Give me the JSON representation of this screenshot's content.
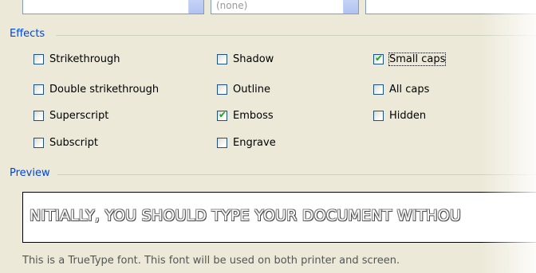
{
  "top_controls": {
    "combo2_value": "(none)"
  },
  "effects": {
    "title": "Effects",
    "options": [
      {
        "label": "Strikethrough",
        "checked": false
      },
      {
        "label": "Double strikethrough",
        "checked": false
      },
      {
        "label": "Superscript",
        "checked": false
      },
      {
        "label": "Subscript",
        "checked": false
      },
      {
        "label": "Shadow",
        "checked": false
      },
      {
        "label": "Outline",
        "checked": false
      },
      {
        "label": "Emboss",
        "checked": true
      },
      {
        "label": "Engrave",
        "checked": false
      },
      {
        "label": "Small caps",
        "checked": true
      },
      {
        "label": "All caps",
        "checked": false
      },
      {
        "label": "Hidden",
        "checked": false
      }
    ]
  },
  "preview": {
    "title": "Preview",
    "sample_text": "NITIALLY, YOU SHOULD TYPE YOUR DOCUMENT WITHOU",
    "note": "This is a TrueType font. This font will be used on both printer and screen."
  },
  "colors": {
    "group_title": "#0046d5",
    "checkmark": "#21a121",
    "dialog_bg": "#ece9d8"
  }
}
